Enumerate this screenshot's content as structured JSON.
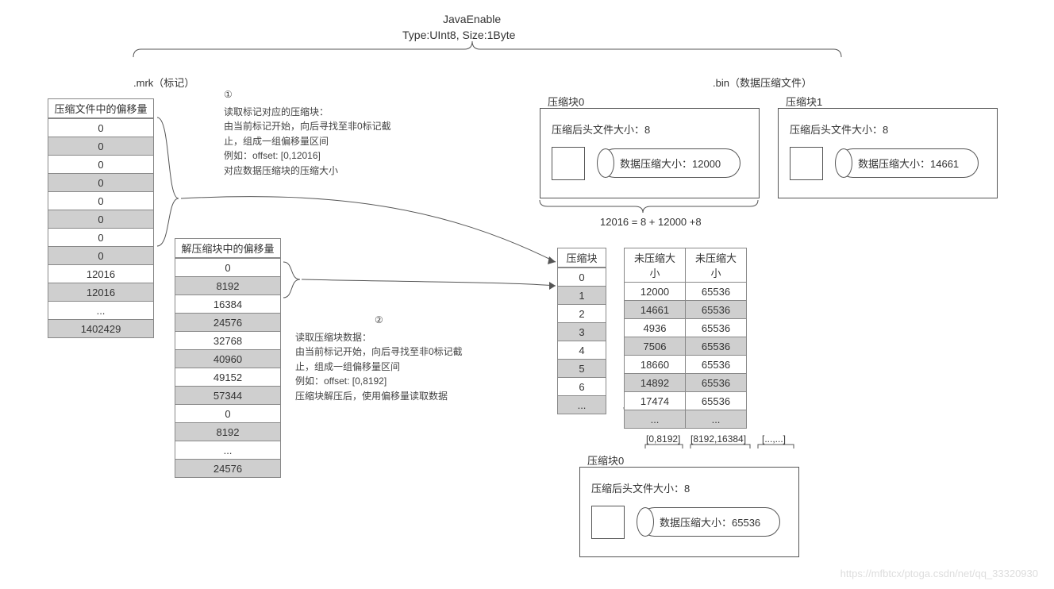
{
  "header": {
    "title": "JavaEnable",
    "subtitle": "Type:UInt8,    Size:1Byte",
    "mrk_label": ".mrk（标记）",
    "bin_label": ".bin（数据压缩文件）"
  },
  "table_offsets": {
    "header": "压缩文件中的偏移量",
    "rows": [
      {
        "v": "0",
        "shade": false
      },
      {
        "v": "0",
        "shade": true
      },
      {
        "v": "0",
        "shade": false
      },
      {
        "v": "0",
        "shade": true
      },
      {
        "v": "0",
        "shade": false
      },
      {
        "v": "0",
        "shade": true
      },
      {
        "v": "0",
        "shade": false
      },
      {
        "v": "0",
        "shade": true
      },
      {
        "v": "12016",
        "shade": false
      },
      {
        "v": "12016",
        "shade": true
      },
      {
        "v": "...",
        "shade": false
      },
      {
        "v": "1402429",
        "shade": true
      }
    ]
  },
  "table_decompress": {
    "header": "解压缩块中的偏移量",
    "rows": [
      {
        "v": "0",
        "shade": false
      },
      {
        "v": "8192",
        "shade": true
      },
      {
        "v": "16384",
        "shade": false
      },
      {
        "v": "24576",
        "shade": true
      },
      {
        "v": "32768",
        "shade": false
      },
      {
        "v": "40960",
        "shade": true
      },
      {
        "v": "49152",
        "shade": false
      },
      {
        "v": "57344",
        "shade": true
      },
      {
        "v": "0",
        "shade": false
      },
      {
        "v": "8192",
        "shade": true
      },
      {
        "v": "...",
        "shade": false
      },
      {
        "v": "24576",
        "shade": true
      }
    ]
  },
  "step1": {
    "num": "①",
    "line1": "读取标记对应的压缩块：",
    "line2": "由当前标记开始，向后寻找至非0标记截",
    "line3": "止，组成一组偏移量区间",
    "line4": "例如：offset: [0,12016]",
    "line5": "对应数据压缩块的压缩大小"
  },
  "step2": {
    "num": "②",
    "line1": "读取压缩块数据：",
    "line2": "由当前标记开始，向后寻找至非0标记截",
    "line3": "止，组成一组偏移量区间",
    "line4": "例如：offset: [0,8192]",
    "line5": "压缩块解压后，使用偏移量读取数据"
  },
  "block0": {
    "label": "压缩块0",
    "headsize": "压缩后头文件大小：8",
    "datasize": "数据压缩大小：12000"
  },
  "block1": {
    "label": "压缩块1",
    "headsize": "压缩后头文件大小：8",
    "datasize": "数据压缩大小：14661"
  },
  "formula": "12016 = 8 + 12000 +8",
  "table_compress_idx": {
    "header": "压缩块",
    "rows": [
      {
        "v": "0",
        "shade": false
      },
      {
        "v": "1",
        "shade": true
      },
      {
        "v": "2",
        "shade": false
      },
      {
        "v": "3",
        "shade": true
      },
      {
        "v": "4",
        "shade": false
      },
      {
        "v": "5",
        "shade": true
      },
      {
        "v": "6",
        "shade": false
      },
      {
        "v": "...",
        "shade": true
      }
    ]
  },
  "table_sizes": {
    "header1": "未压缩大小",
    "header2": "未压缩大小",
    "rows": [
      {
        "a": "12000",
        "b": "65536",
        "shade": false
      },
      {
        "a": "14661",
        "b": "65536",
        "shade": true
      },
      {
        "a": "4936",
        "b": "65536",
        "shade": false
      },
      {
        "a": "7506",
        "b": "65536",
        "shade": true
      },
      {
        "a": "18660",
        "b": "65536",
        "shade": false
      },
      {
        "a": "14892",
        "b": "65536",
        "shade": true
      },
      {
        "a": "17474",
        "b": "65536",
        "shade": false
      },
      {
        "a": "...",
        "b": "...",
        "shade": true
      }
    ]
  },
  "ranges": {
    "r1": "[0,8192]",
    "r2": "[8192,16384]",
    "r3": "[...,...]"
  },
  "block0_bottom": {
    "label": "压缩块0",
    "headsize": "压缩后头文件大小：8",
    "datasize": "数据压缩大小：65536"
  },
  "watermark": "https://mfbtcx/ptoga.csdn/net/qq_33320930"
}
